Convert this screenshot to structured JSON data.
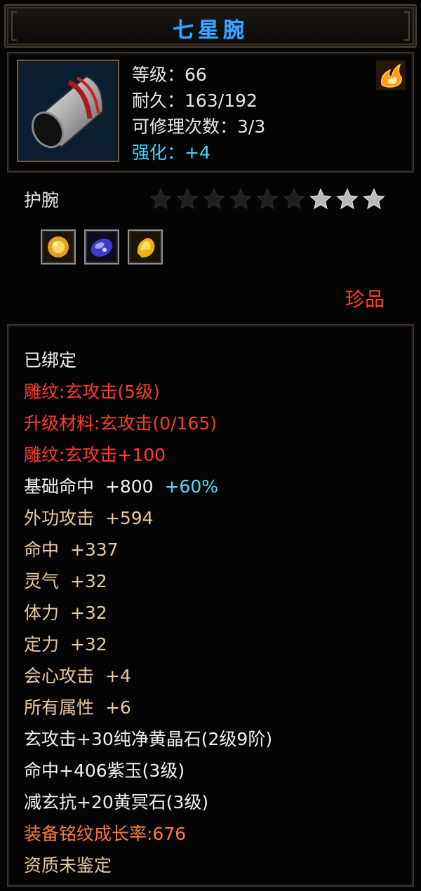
{
  "item": {
    "name": "七星腕",
    "level": "等级：66",
    "durability": "耐久：163/192",
    "repairs": "可修理次数：3/3",
    "enhance_label": "强化：",
    "enhance_value": "+4",
    "type": "护腕",
    "rarity": "珍品",
    "icon": "bracer-icon",
    "badge_icon": "flame-icon",
    "stars_total": 9,
    "stars_lit": 3
  },
  "gems": [
    "gold-gem-icon",
    "sapphire-gem-icon",
    "topaz-gem-icon"
  ],
  "attributes": {
    "bound": "已绑定",
    "engrave1": "雕纹:玄攻击(5级)",
    "upgrade_material": "升级材料:玄攻击(0/165)",
    "engrave2": "雕纹:玄攻击+100",
    "hit_base": "基础命中  +800",
    "hit_base_bonus": "+60%",
    "outer_attack": "外功攻击  +594",
    "hit": "命中  +337",
    "spirit": "灵气  +32",
    "stamina": "体力  +32",
    "focus": "定力  +32",
    "crit_attack": "会心攻击  +4",
    "all_attr": "所有属性  +6",
    "gem1": "玄攻击+30纯净黄晶石(2级9阶)",
    "gem2": "命中+406紫玉(3级)",
    "gem3": "减玄抗+20黄冥石(3级)",
    "growth": "装备铭纹成长率:676",
    "aptitude": "资质未鉴定"
  },
  "colors": {
    "title": "#3aa6ff",
    "enhance": "#3fd6ff",
    "red": "#ff3a2c",
    "tan": "#e8c9a0",
    "orange": "#ff7a3c"
  }
}
